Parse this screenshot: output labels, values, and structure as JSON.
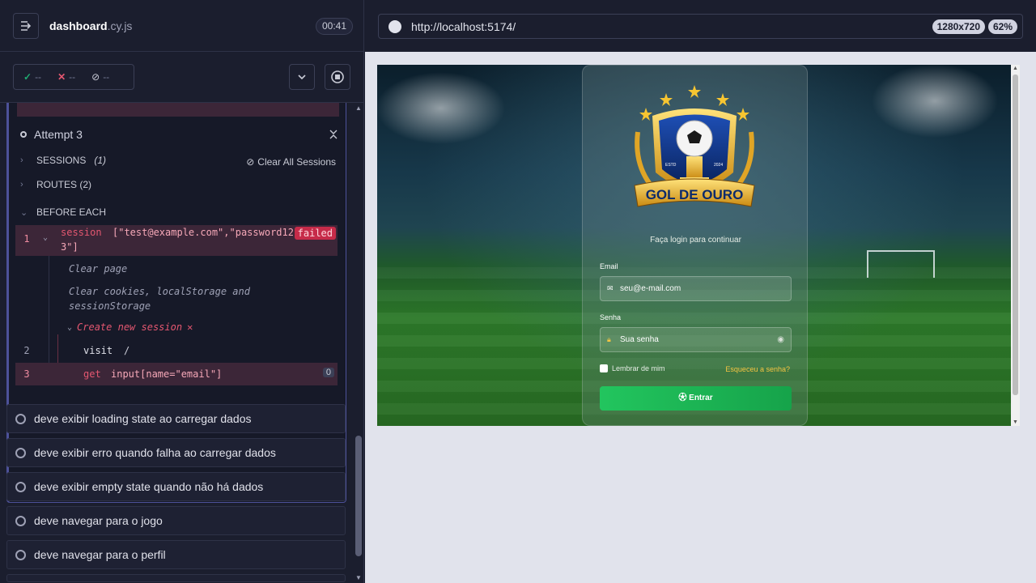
{
  "header": {
    "spec_name": "dashboard",
    "spec_ext": ".cy.js",
    "timer": "00:41"
  },
  "stats": {
    "passed": "--",
    "failed": "--",
    "pending": "--"
  },
  "attempt": {
    "label": "Attempt 3"
  },
  "sections": {
    "sessions_label": "SESSIONS",
    "sessions_count": "(1)",
    "clear_sessions": "Clear All Sessions",
    "routes_label": "ROUTES (2)",
    "before_each_label": "BEFORE EACH"
  },
  "commands": {
    "session": {
      "num": "1",
      "name": "session",
      "arg_line1": "[\"test@example.com\",\"password12",
      "arg_line2": "3\"]",
      "badge": "failed"
    },
    "clear_page": "Clear page",
    "clear_storage_1": "Clear cookies, localStorage and",
    "clear_storage_2": "sessionStorage",
    "create_session": "Create new session",
    "visit": {
      "num": "2",
      "name": "visit",
      "arg": "/"
    },
    "get": {
      "num": "3",
      "name": "get",
      "arg": "input[name=\"email\"]",
      "count": "0"
    }
  },
  "tests": [
    "deve exibir loading state ao carregar dados",
    "deve exibir erro quando falha ao carregar dados",
    "deve exibir empty state quando não há dados",
    "deve navegar para o jogo",
    "deve navegar para o perfil"
  ],
  "browser": {
    "url": "http://localhost:5174/",
    "viewport": "1280x720",
    "zoom": "62%"
  },
  "app": {
    "logo_text": "GOL DE OURO",
    "logo_estd": "ESTD",
    "logo_year": "2024",
    "subtitle": "Faça login para continuar",
    "email_label": "Email",
    "email_placeholder": "seu@e-mail.com",
    "password_label": "Senha",
    "password_placeholder": "Sua senha",
    "remember_label": "Lembrar de mim",
    "forgot_label": "Esqueceu a senha?",
    "submit_label": "Entrar"
  },
  "colors": {
    "pass": "#1fa971",
    "fail": "#e45770",
    "submit": "#22c55e",
    "forgot": "#f5c542"
  }
}
